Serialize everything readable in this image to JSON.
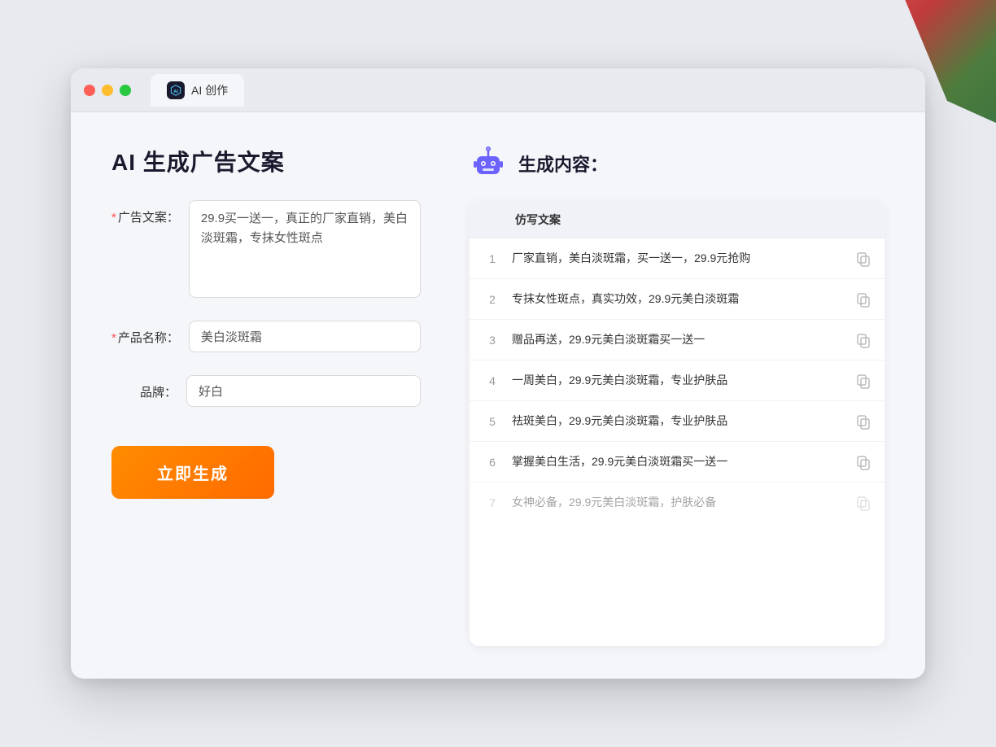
{
  "window": {
    "title": "AI 创作",
    "tab_label": "AI 创作"
  },
  "traffic_lights": {
    "red": "red",
    "yellow": "yellow",
    "green": "green"
  },
  "left": {
    "page_title": "AI 生成广告文案",
    "form": {
      "ad_copy_label": "广告文案：",
      "ad_copy_required": "*",
      "ad_copy_value": "29.9买一送一，真正的厂家直销，美白淡斑霜，专抹女性斑点",
      "product_name_label": "产品名称：",
      "product_name_required": "*",
      "product_name_value": "美白淡斑霜",
      "brand_label": "品牌：",
      "brand_value": "好白"
    },
    "generate_button": "立即生成"
  },
  "right": {
    "result_title": "生成内容：",
    "table_header": "仿写文案",
    "rows": [
      {
        "num": "1",
        "text": "厂家直销，美白淡斑霜，买一送一，29.9元抢购",
        "dimmed": false
      },
      {
        "num": "2",
        "text": "专抹女性斑点，真实功效，29.9元美白淡斑霜",
        "dimmed": false
      },
      {
        "num": "3",
        "text": "赠品再送，29.9元美白淡斑霜买一送一",
        "dimmed": false
      },
      {
        "num": "4",
        "text": "一周美白，29.9元美白淡斑霜，专业护肤品",
        "dimmed": false
      },
      {
        "num": "5",
        "text": "祛斑美白，29.9元美白淡斑霜，专业护肤品",
        "dimmed": false
      },
      {
        "num": "6",
        "text": "掌握美白生活，29.9元美白淡斑霜买一送一",
        "dimmed": false
      },
      {
        "num": "7",
        "text": "女神必备，29.9元美白淡斑霜，护肤必备",
        "dimmed": true
      }
    ]
  }
}
